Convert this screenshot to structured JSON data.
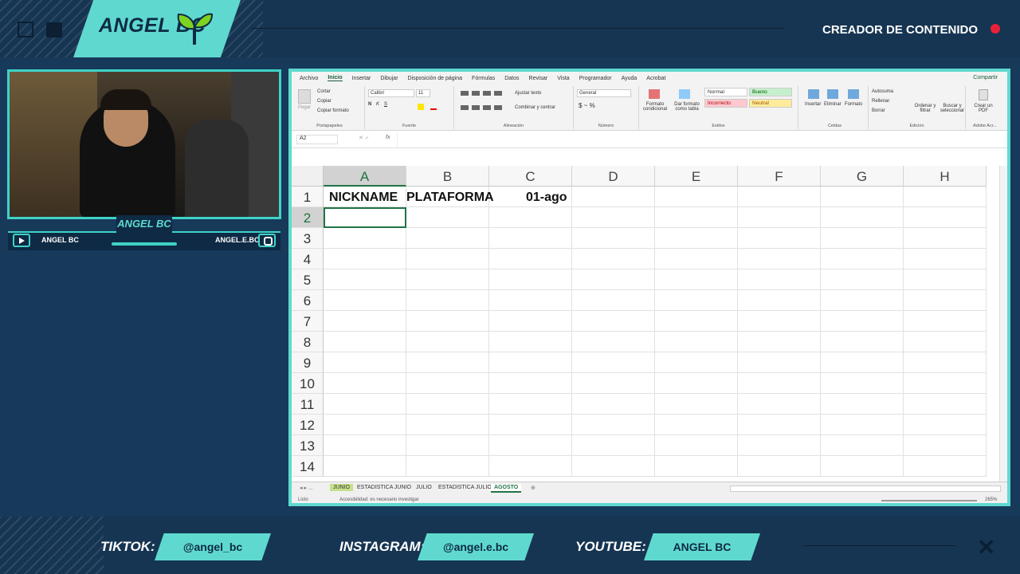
{
  "overlay": {
    "brand_name": "ANGEL BC",
    "header_tag": "CREADOR DE CONTENIDO",
    "cam_label": "ANGEL BC",
    "cam_youtube_handle": "ANGEL BC",
    "cam_instagram_handle": "ANGEL.E.BC",
    "socials": {
      "tiktok_label": "TIKTOK:",
      "tiktok_handle": "@angel_bc",
      "instagram_label": "INSTAGRAM:",
      "instagram_handle": "@angel.e.bc",
      "youtube_label": "YOUTUBE:",
      "youtube_handle": "ANGEL BC"
    },
    "colors": {
      "accent": "#5fd9cf",
      "background": "#17395a",
      "record": "#e8213b"
    }
  },
  "excel": {
    "menu": [
      "Archivo",
      "Inicio",
      "Insertar",
      "Dibujar",
      "Disposición de página",
      "Fórmulas",
      "Datos",
      "Revisar",
      "Vista",
      "Programador",
      "Ayuda",
      "Acrobat"
    ],
    "active_menu": "Inicio",
    "share_label": "Compartir",
    "ribbon": {
      "clipboard": {
        "cut": "Cortar",
        "copy": "Copiar",
        "format_painter": "Copiar formato",
        "paste": "Pegar",
        "label": "Portapapeles"
      },
      "font": {
        "name": "Calibri",
        "size": "11",
        "bold": "N",
        "italic": "K",
        "underline": "S",
        "label": "Fuente"
      },
      "alignment": {
        "wrap": "Ajustar texto",
        "merge": "Combinar y centrar",
        "label": "Alineación"
      },
      "number": {
        "format": "General",
        "label": "Número"
      },
      "styles": {
        "conditional": "Formato condicional",
        "as_table": "Dar formato como tabla",
        "normal": "Normal",
        "bueno": "Bueno",
        "incorrecto": "Incorrecto",
        "neutral": "Neutral",
        "label": "Estilos"
      },
      "cells": {
        "insert": "Insertar",
        "delete": "Eliminar",
        "format": "Formato",
        "label": "Celdas"
      },
      "editing": {
        "autosum": "Autosuma",
        "fill": "Rellenar",
        "clear": "Borrar",
        "sort": "Ordenar y filtrar",
        "find": "Buscar y seleccionar",
        "label": "Edición"
      },
      "pdf": {
        "create": "Crear un PDF",
        "label": "Adobe Acr..."
      }
    },
    "name_box": "A2",
    "fx_symbol": "fx",
    "columns": [
      "A",
      "B",
      "C",
      "D",
      "E",
      "F",
      "G",
      "H"
    ],
    "selected_column": "A",
    "rows": [
      "1",
      "2",
      "3",
      "4",
      "5",
      "6",
      "7",
      "8",
      "9",
      "10",
      "11",
      "12",
      "13",
      "14"
    ],
    "selected_row": "2",
    "cells": {
      "A1": "NICKNAME",
      "B1": "PLATAFORMA",
      "C1": "01-ago"
    },
    "sheets": [
      "JUNIO",
      "ESTADISTICA JUNIO",
      "JULIO",
      "ESTADISTICA JULIO",
      "AGOSTO"
    ],
    "active_sheet": "AGOSTO",
    "status_left": "Listo",
    "status_accessibility": "Accesibilidad: es necesario investigar",
    "zoom": "265%"
  }
}
